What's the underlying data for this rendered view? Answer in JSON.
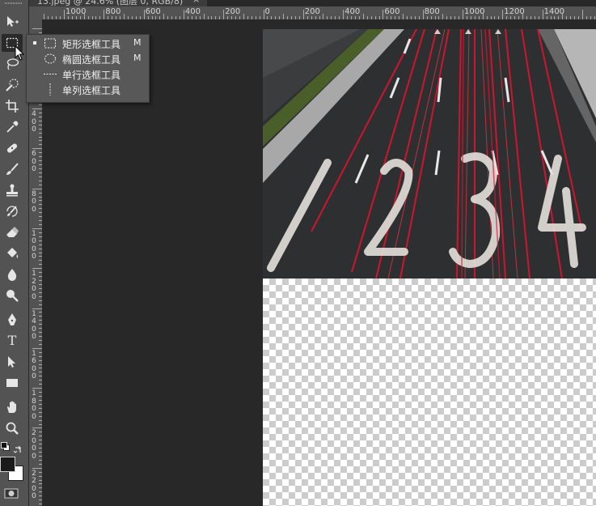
{
  "document": {
    "tab_title": "13.jpeg @ 24.6% (图层 0, RGB/8)",
    "tab_close": "×"
  },
  "ruler": {
    "top_labels": [
      "1000",
      "800",
      "600",
      "400",
      "200",
      "0",
      "200",
      "400",
      "600",
      "800",
      "1000",
      "1200",
      "1400"
    ],
    "left_labels": [
      "4\n0\n0",
      "6\n0\n0",
      "8\n0\n0",
      "1\n0\n0\n0",
      "1\n2\n0\n0",
      "1\n4\n0\n0",
      "1\n6\n0\n0",
      "1\n8\n0\n0",
      "2\n0\n0\n0",
      "2\n2\n0\n0"
    ]
  },
  "toolbar": {
    "tools": [
      {
        "name": "move-tool",
        "icon": "move-icon"
      },
      {
        "name": "rectangular-marquee-tool",
        "icon": "marquee-icon",
        "active": true
      },
      {
        "name": "lasso-tool",
        "icon": "lasso-icon"
      },
      {
        "name": "quick-selection-tool",
        "icon": "quick-selection-icon"
      },
      {
        "name": "crop-tool",
        "icon": "crop-icon"
      },
      {
        "name": "eyedropper-tool",
        "icon": "eyedropper-icon"
      },
      {
        "name": "healing-brush-tool",
        "icon": "bandage-icon"
      },
      {
        "name": "brush-tool",
        "icon": "brush-icon"
      },
      {
        "name": "clone-stamp-tool",
        "icon": "stamp-icon"
      },
      {
        "name": "history-brush-tool",
        "icon": "history-brush-icon"
      },
      {
        "name": "eraser-tool",
        "icon": "eraser-icon"
      },
      {
        "name": "paint-bucket-tool",
        "icon": "paint-bucket-icon"
      },
      {
        "name": "blur-tool",
        "icon": "drop-icon"
      },
      {
        "name": "dodge-tool",
        "icon": "dodge-icon"
      },
      {
        "name": "pen-tool",
        "icon": "pen-icon"
      },
      {
        "name": "type-tool",
        "icon": "type-icon",
        "label": "T"
      },
      {
        "name": "path-selection-tool",
        "icon": "path-selection-icon"
      },
      {
        "name": "rectangle-tool",
        "icon": "rectangle-icon"
      },
      {
        "name": "hand-tool",
        "icon": "hand-icon"
      },
      {
        "name": "zoom-tool",
        "icon": "zoom-icon"
      }
    ],
    "foreground_color": "#1a1a1a",
    "background_color": "#ffffff"
  },
  "flyout": {
    "items": [
      {
        "label": "矩形选框工具",
        "shortcut": "M",
        "icon": "rect-marquee-icon",
        "selected": true
      },
      {
        "label": "椭圆选框工具",
        "shortcut": "M",
        "icon": "ellipse-marquee-icon",
        "selected": false
      },
      {
        "label": "单行选框工具",
        "shortcut": "",
        "icon": "single-row-marquee-icon",
        "selected": false
      },
      {
        "label": "单列选框工具",
        "shortcut": "",
        "icon": "single-column-marquee-icon",
        "selected": false
      }
    ]
  },
  "image": {
    "road_numbers": [
      "1",
      "2",
      "3",
      "4"
    ]
  },
  "colors": {
    "panel": "#535353",
    "canvas_bg": "#282828",
    "accent_red": "#e0132f"
  }
}
